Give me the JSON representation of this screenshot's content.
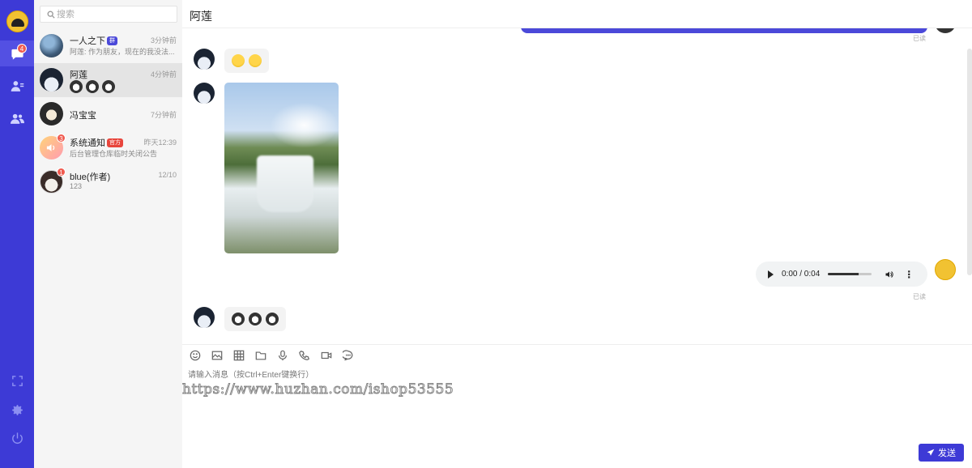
{
  "search": {
    "placeholder": "搜索"
  },
  "rail": {
    "chat_badge": "4"
  },
  "conversations": [
    {
      "name": "一人之下",
      "tag": "群",
      "time": "3分钟前",
      "preview": "阿莲: 作为朋友，现在的我没法..."
    },
    {
      "name": "阿莲",
      "time": "4分钟前",
      "preview_icons": [
        "emoji",
        "emoji",
        "emoji"
      ]
    },
    {
      "name": "冯宝宝",
      "time": "7分钟前"
    },
    {
      "name": "系统通知",
      "tag": "官方",
      "badge": "3",
      "time": "昨天12:39",
      "preview": "后台管理仓库临时关闭公告"
    },
    {
      "name": "blue(作者)",
      "badge": "1",
      "time": "12/10",
      "preview": "123"
    }
  ],
  "chat": {
    "title": "阿莲",
    "read_label": "已读",
    "audio": {
      "time": "0:00 / 0:04",
      "progress": 0.7
    },
    "input_placeholder": "请输入消息（按Ctrl+Enter键换行）",
    "send_label": "发送",
    "watermark": "https://www.huzhan.com/ishop53555"
  },
  "icons": [
    "emoji-icon",
    "image-icon",
    "table-icon",
    "folder-icon",
    "mic-icon",
    "phone-icon",
    "video-icon",
    "chat-icon"
  ],
  "colors": {
    "accent": "#3d3ad6",
    "badge": "#f05a4f",
    "official": "#e8453c"
  }
}
